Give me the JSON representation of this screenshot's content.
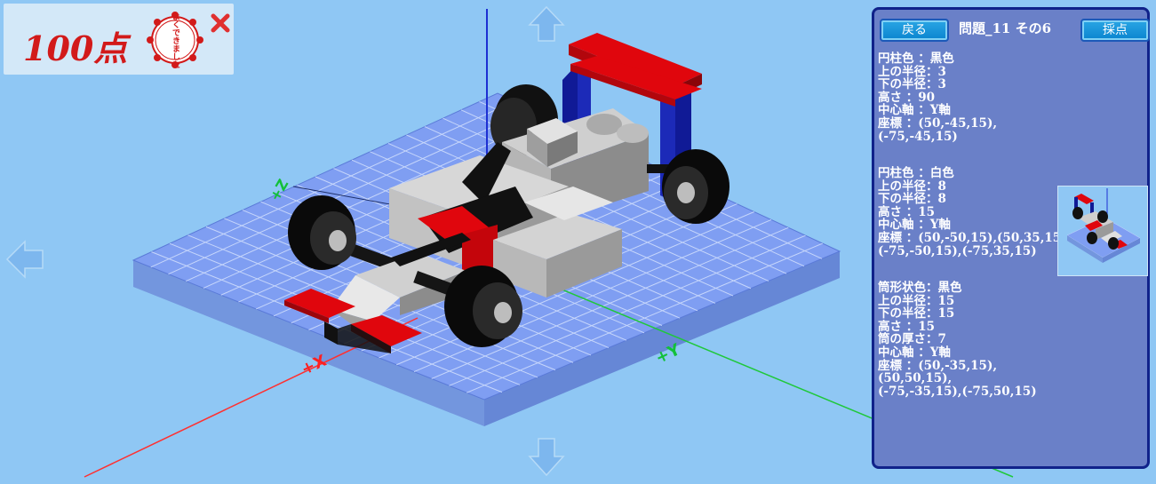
{
  "score": {
    "text": "100点",
    "stamp_text": "よくできました"
  },
  "close": {
    "icon": "close-icon"
  },
  "axes": {
    "x_label": "+X",
    "y_label": "+Y",
    "z_label": "+Z"
  },
  "panel": {
    "back_label": "戻る",
    "grade_label": "採点",
    "title": "問題_11 その6",
    "spec1": "円柱色 ：黒色\n上の半径：3\n下の半径：3\n高さ ：90\n中心軸 ：Y軸\n座標 ：(50,-45,15),\n(-75,-45,15)",
    "spec2": "円柱色 ：白色\n上の半径：8\n下の半径：8\n高さ ：15\n中心軸 ：Y軸\n座標 ：(50,-50,15),(50,35,15),\n(-75,-50,15),(-75,35,15)",
    "spec3": "筒形状色：黒色\n上の半径：15\n下の半径：15\n高さ ：15\n筒の厚さ：7\n中心軸 ：Y軸\n座標 ：(50,-35,15),\n(50,50,15),\n(-75,-35,15),(-75,50,15)"
  },
  "colors": {
    "background": "#8fc7f4",
    "grid": "#7f9ef2",
    "panel": "#6a80c8",
    "panel_border": "#10228a",
    "red": "#e0060d",
    "navy": "#0e1a9a",
    "score_red": "#d21a1a"
  }
}
